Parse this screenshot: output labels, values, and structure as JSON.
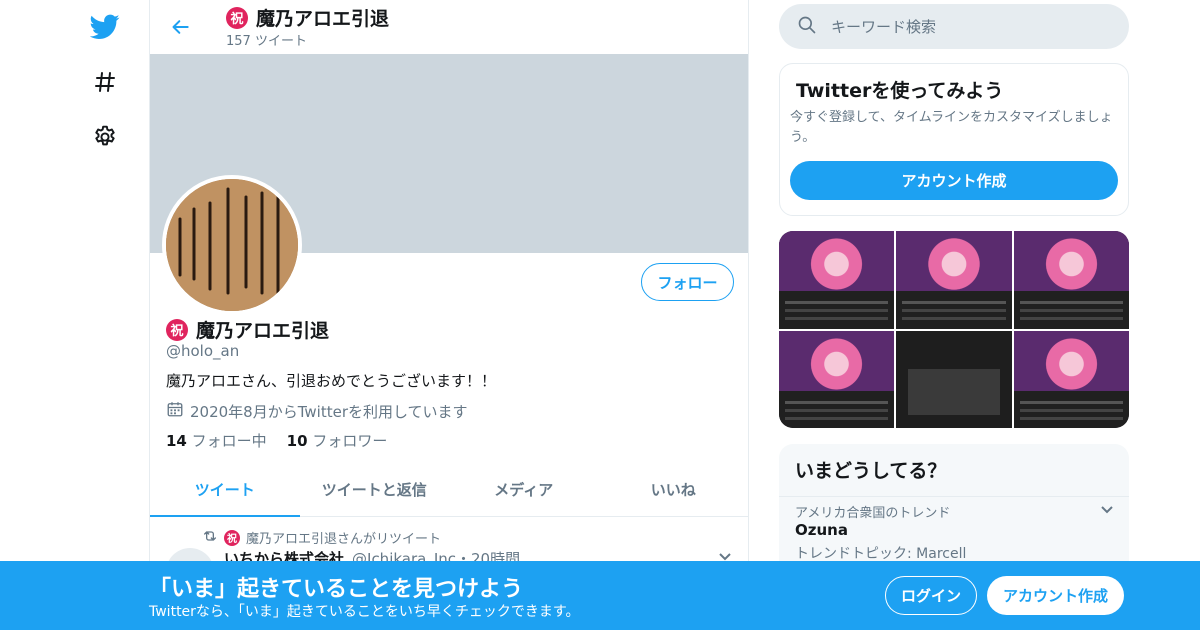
{
  "colors": {
    "brand": "#1da1f2",
    "banner": "#ccd6dd",
    "muted": "#657786",
    "badge": "#e0245e"
  },
  "nav": {
    "items": [
      {
        "icon": "twitter-bird-icon"
      },
      {
        "icon": "hashtag-icon"
      },
      {
        "icon": "gear-icon"
      }
    ]
  },
  "profile_header": {
    "badge": "祝",
    "title": "魔乃アロエ引退",
    "tweet_count": "157 ツイート"
  },
  "profile": {
    "badge": "祝",
    "name": "魔乃アロエ引退",
    "handle": "@holo_an",
    "bio": "魔乃アロエさん、引退おめでとうございます！！",
    "joined": "2020年8月からTwitterを利用しています",
    "following_count": "14",
    "following_label": "フォロー中",
    "followers_count": "10",
    "followers_label": "フォロワー",
    "follow_button": "フォロー"
  },
  "tabs": [
    {
      "label": "ツイート",
      "active": true
    },
    {
      "label": "ツイートと返信",
      "active": false
    },
    {
      "label": "メディア",
      "active": false
    },
    {
      "label": "いいね",
      "active": false
    }
  ],
  "tweet": {
    "retweet_badge": "祝",
    "retweet_text": "魔乃アロエ引退さんがリツイート",
    "author": "いちから株式会社",
    "author_meta": "@Ichikara_Inc・20時間"
  },
  "search": {
    "placeholder": "キーワード検索"
  },
  "signup_card": {
    "title": "Twitterを使ってみよう",
    "description": "今すぐ登録して、タイムラインをカスタマイズしましょう。",
    "button": "アカウント作成"
  },
  "trends": {
    "title": "いまどうしてる？",
    "context": "アメリカ合衆国のトレンド",
    "name": "Ozuna",
    "topic": "トレンドトピック: Marcell"
  },
  "bottom_bar": {
    "title": "「いま」起きていることを見つけよう",
    "subtitle": "Twitterなら、「いま」起きていることをいち早くチェックできます。",
    "login": "ログイン",
    "signup": "アカウント作成"
  }
}
